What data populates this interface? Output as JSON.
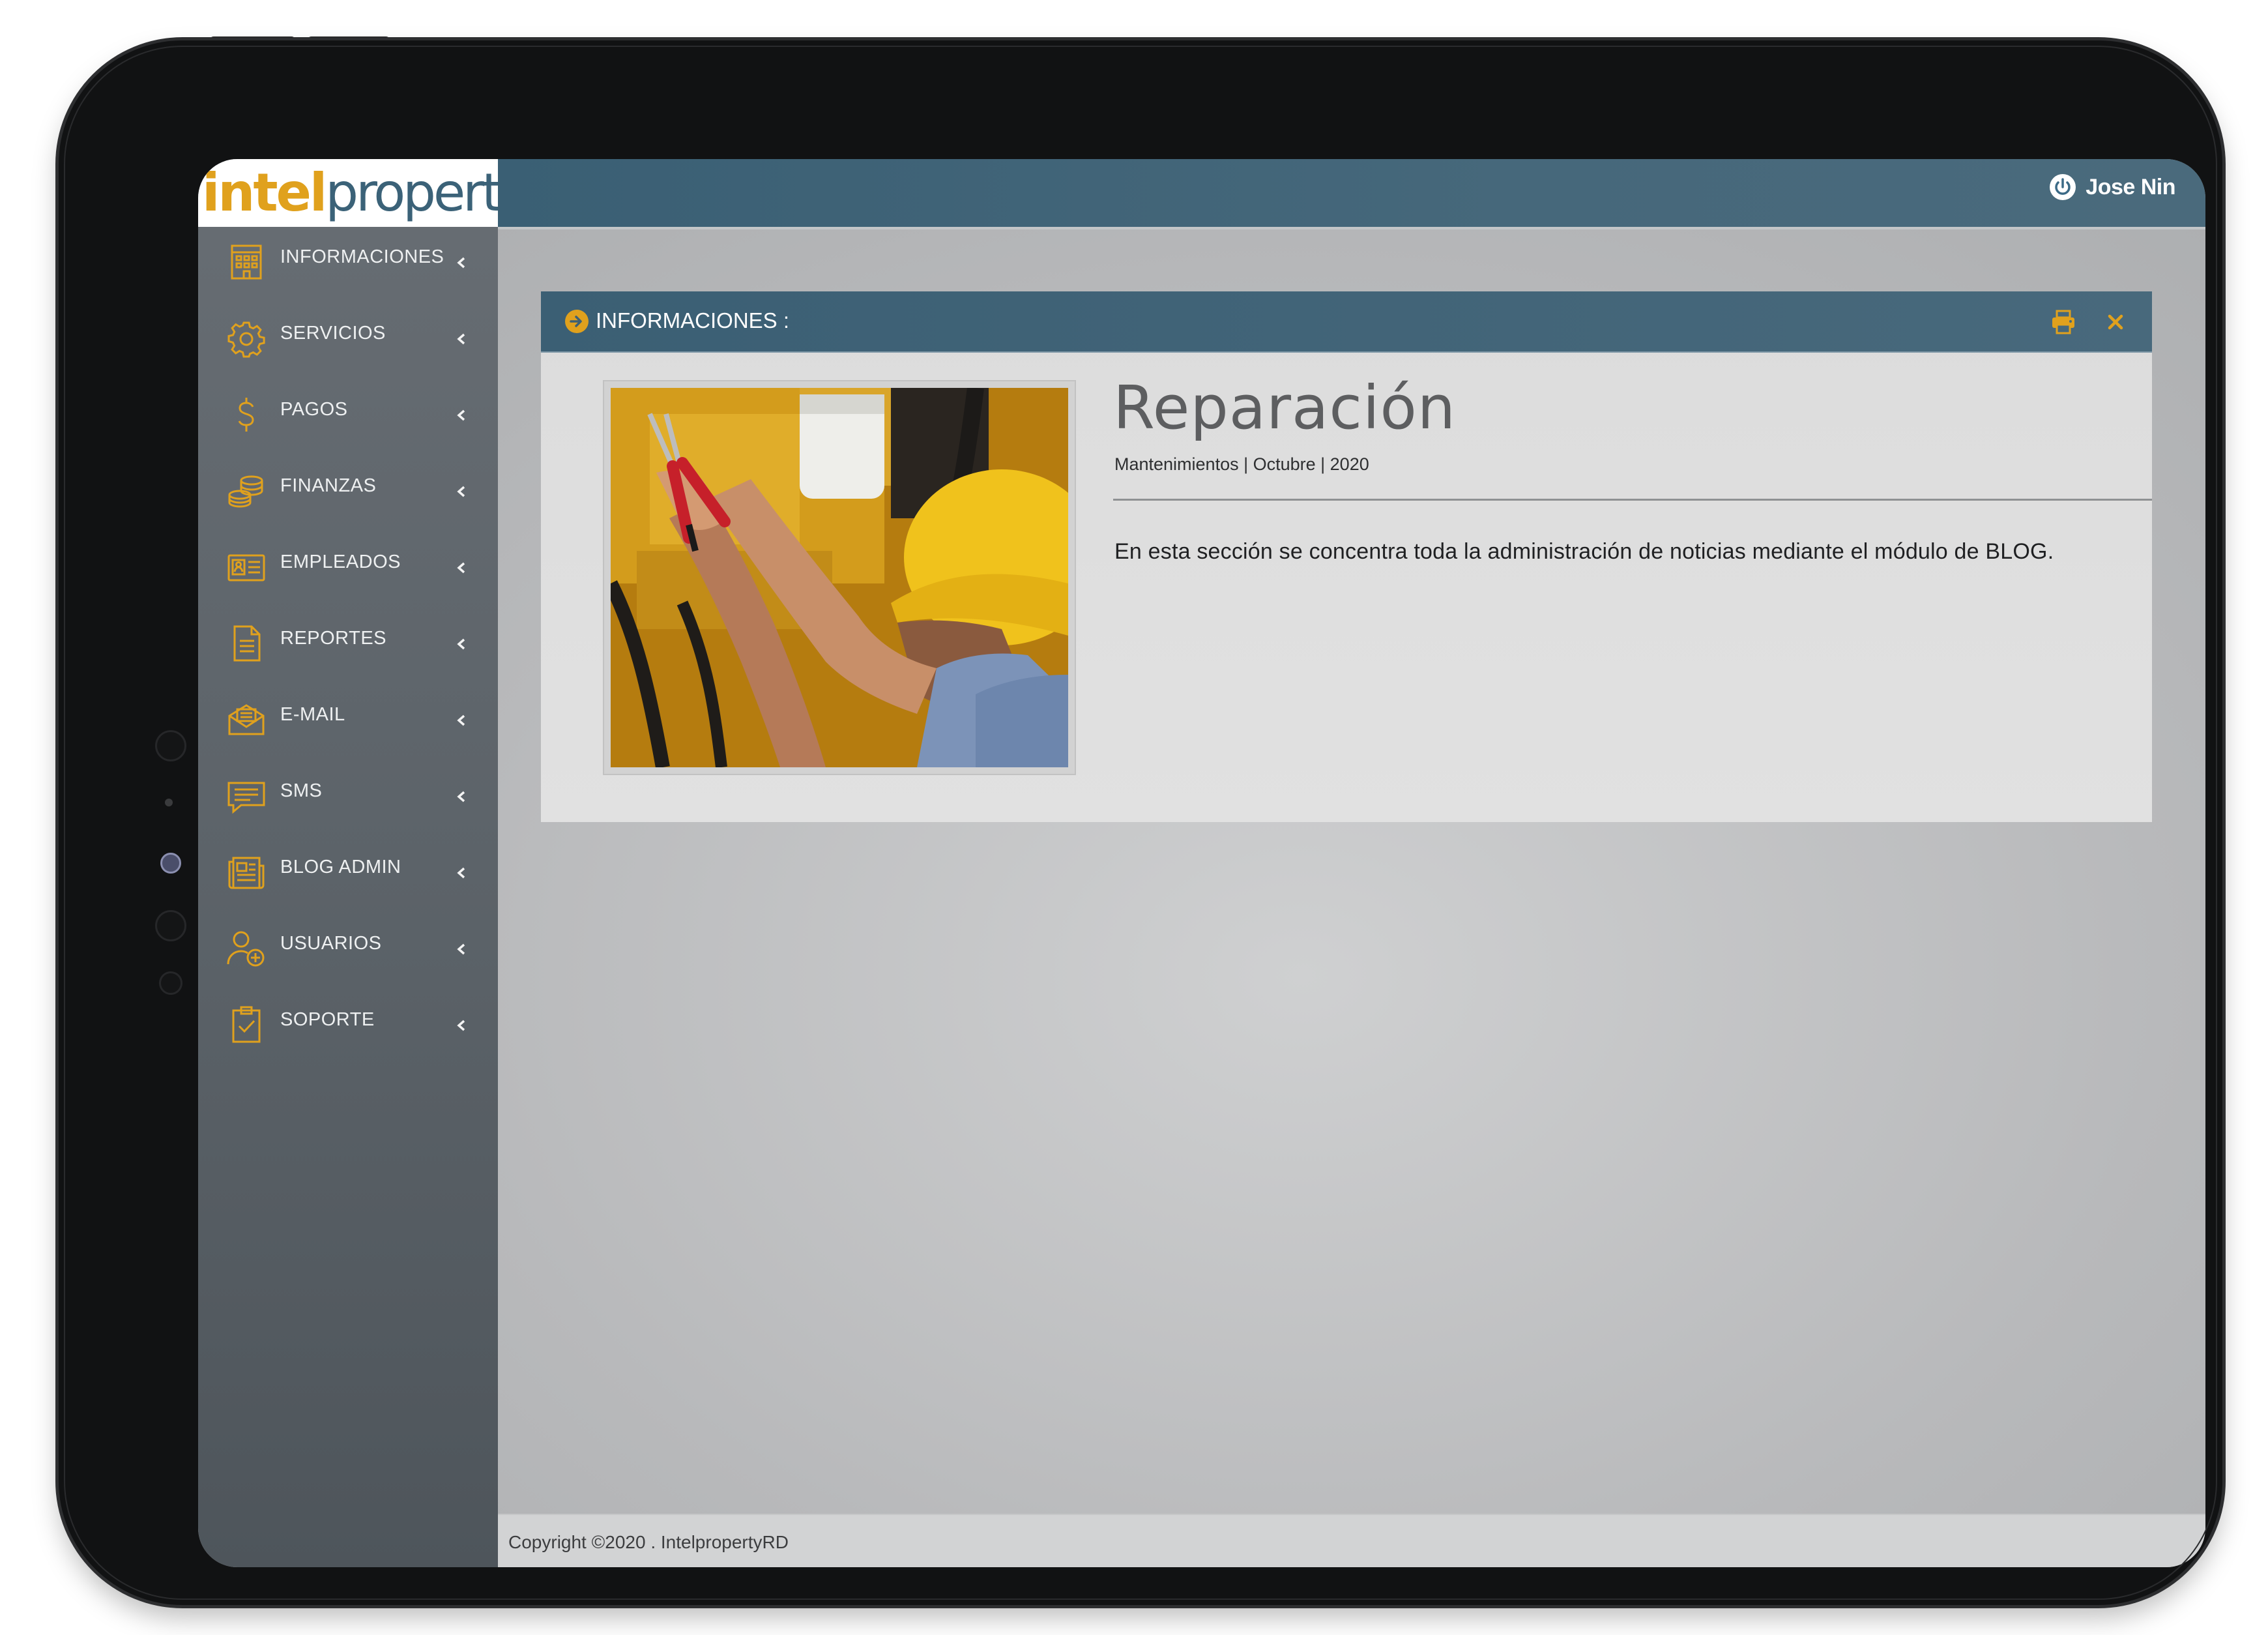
{
  "app": {
    "logo": {
      "part1": "intel",
      "part2": "property"
    },
    "user": {
      "name": "Jose Nin"
    }
  },
  "colors": {
    "accent": "#e0a11d",
    "header": "#3f6477",
    "sidebar": "#5b6268"
  },
  "sidebar": {
    "items": [
      {
        "label": "INFORMACIONES",
        "icon": "building-icon"
      },
      {
        "label": "SERVICIOS",
        "icon": "gear-icon"
      },
      {
        "label": "PAGOS",
        "icon": "dollar-icon"
      },
      {
        "label": "FINANZAS",
        "icon": "coins-icon"
      },
      {
        "label": "EMPLEADOS",
        "icon": "id-card-icon"
      },
      {
        "label": "REPORTES",
        "icon": "document-icon"
      },
      {
        "label": "E-MAIL",
        "icon": "envelope-icon"
      },
      {
        "label": "SMS",
        "icon": "chat-icon"
      },
      {
        "label": "BLOG ADMIN",
        "icon": "newspaper-icon"
      },
      {
        "label": "USUARIOS",
        "icon": "user-add-icon"
      },
      {
        "label": "SOPORTE",
        "icon": "clipboard-check-icon"
      }
    ]
  },
  "panel": {
    "title": "INFORMACIONES :",
    "post": {
      "title": "Reparación",
      "meta": "Mantenimientos | Octubre | 2020",
      "body": "En esta sección se concentra toda la administración de noticias mediante el módulo de BLOG."
    }
  },
  "footer": {
    "copyright": "Copyright ©2020 . IntelpropertyRD"
  }
}
